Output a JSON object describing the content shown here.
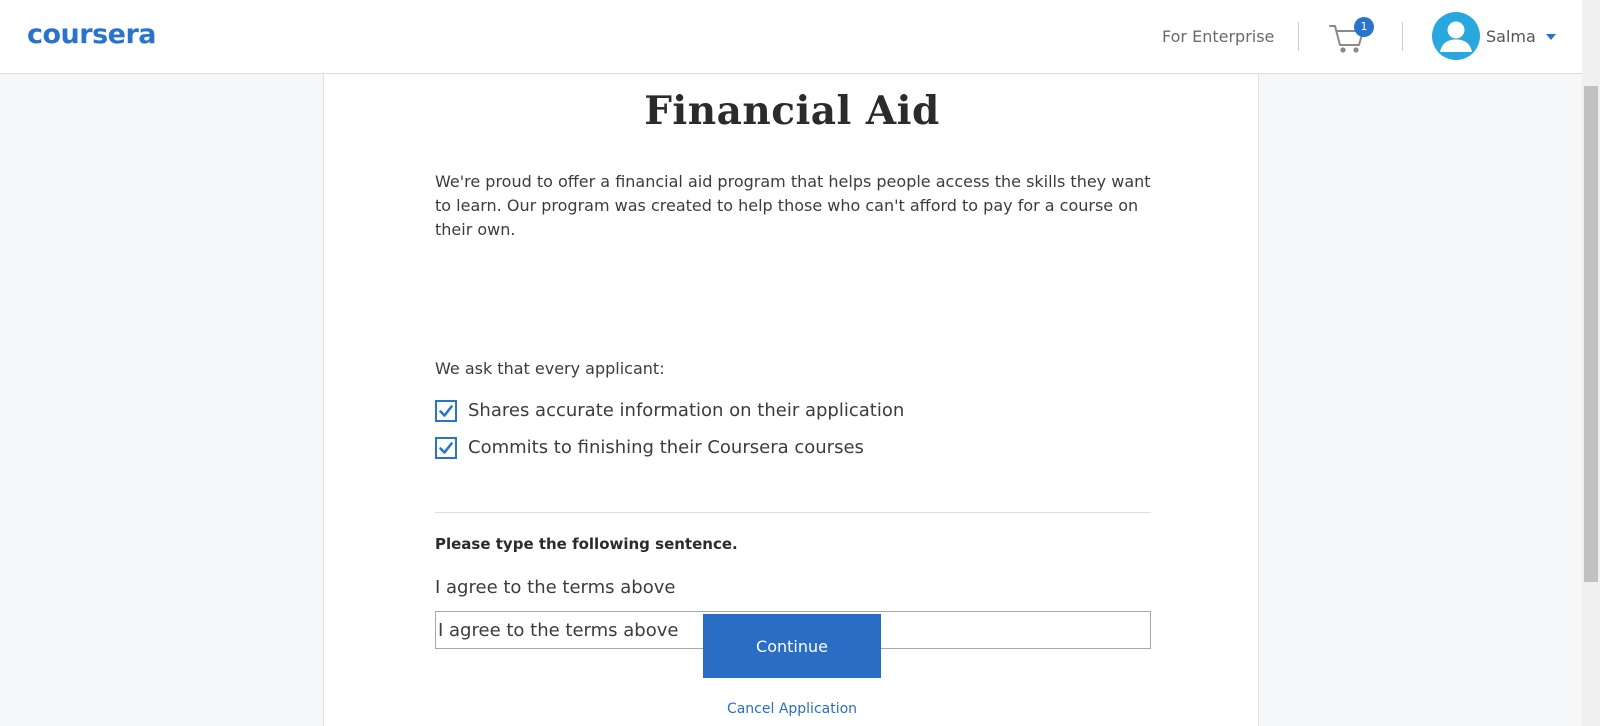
{
  "header": {
    "logo_text": "coursera",
    "enterprise_link": "For Enterprise",
    "cart_icon": "cart-icon",
    "cart_count": "1",
    "user_name": "Salma",
    "avatar_icon": "user-avatar-icon",
    "brand_color": "#2a73cc"
  },
  "main": {
    "title": "Financial Aid",
    "intro": "We're proud to offer a financial aid program that helps people access the skills they want to learn. Our program was created to help those who can't afford to pay for a course on their own.",
    "ask_heading": "We ask that every applicant:",
    "requirements": [
      {
        "label": "Shares accurate information on their application",
        "checked": true
      },
      {
        "label": "Commits to finishing their Coursera courses",
        "checked": true
      }
    ],
    "prompt": "Please type the following sentence.",
    "sentence": "I agree to the terms above",
    "input_value": "I agree to the terms above",
    "continue_label": "Continue",
    "cancel_label": "Cancel Application"
  }
}
